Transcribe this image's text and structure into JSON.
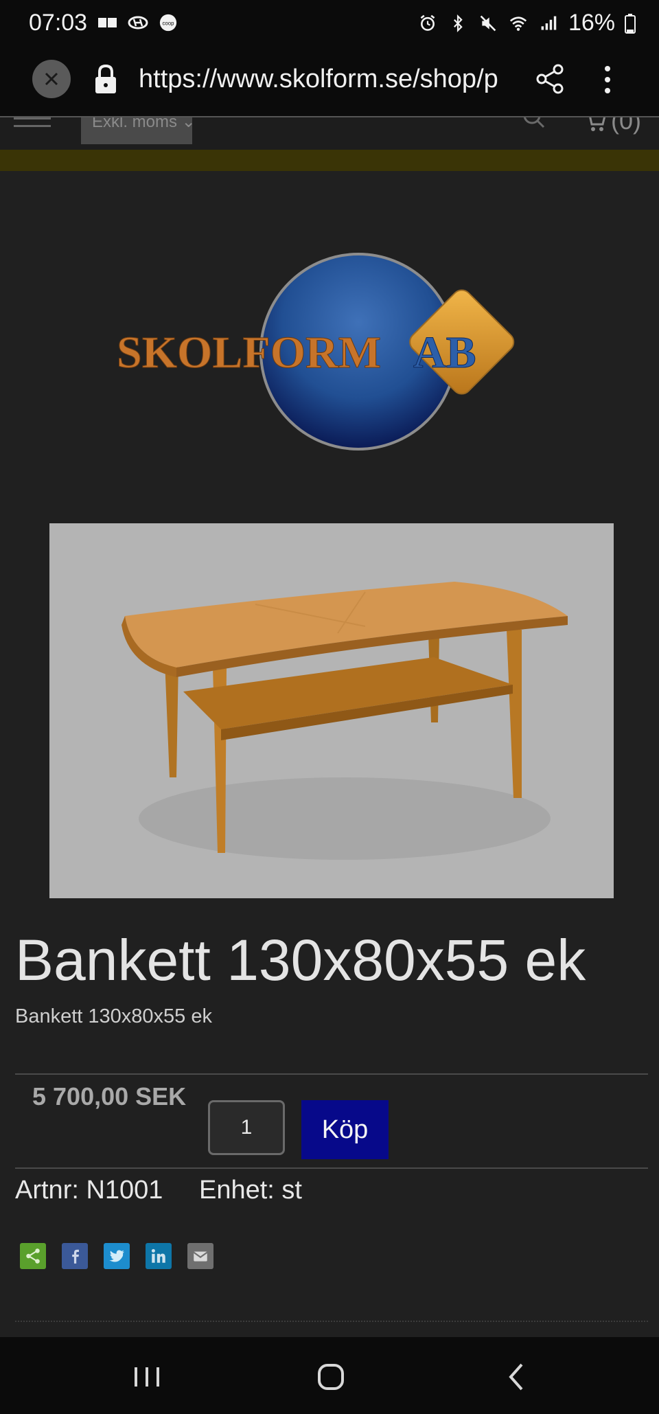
{
  "status_bar": {
    "time": "07:03",
    "battery": "16%",
    "left_icons": [
      "ad-icon",
      "hyundai-icon",
      "coop-icon"
    ],
    "right_icons": [
      "alarm-icon",
      "bluetooth-icon",
      "mute-icon",
      "wifi-icon",
      "signal-icon",
      "battery-icon"
    ]
  },
  "browser": {
    "url": "https://www.skolform.se/shop/p"
  },
  "site_header": {
    "menu_label": "Exkl. moms",
    "cart_count": "(0)"
  },
  "logo": {
    "text": "SKOLFORM AB"
  },
  "product": {
    "title": "Bankett 130x80x55 ek",
    "subtitle": "Bankett 130x80x55 ek",
    "price": "5 700,00 SEK",
    "quantity": "1",
    "buy_label": "Köp",
    "article_number": "Artnr: N1001",
    "unit": "Enhet: st"
  },
  "social": [
    {
      "name": "share",
      "color": "#5aa02c"
    },
    {
      "name": "facebook",
      "color": "#3b5998"
    },
    {
      "name": "twitter",
      "color": "#1d8dce"
    },
    {
      "name": "linkedin",
      "color": "#0e76a8"
    },
    {
      "name": "email",
      "color": "#6f6f6f"
    }
  ],
  "colors": {
    "accent_bar": "#3a3406",
    "buy_button": "#07098a"
  }
}
